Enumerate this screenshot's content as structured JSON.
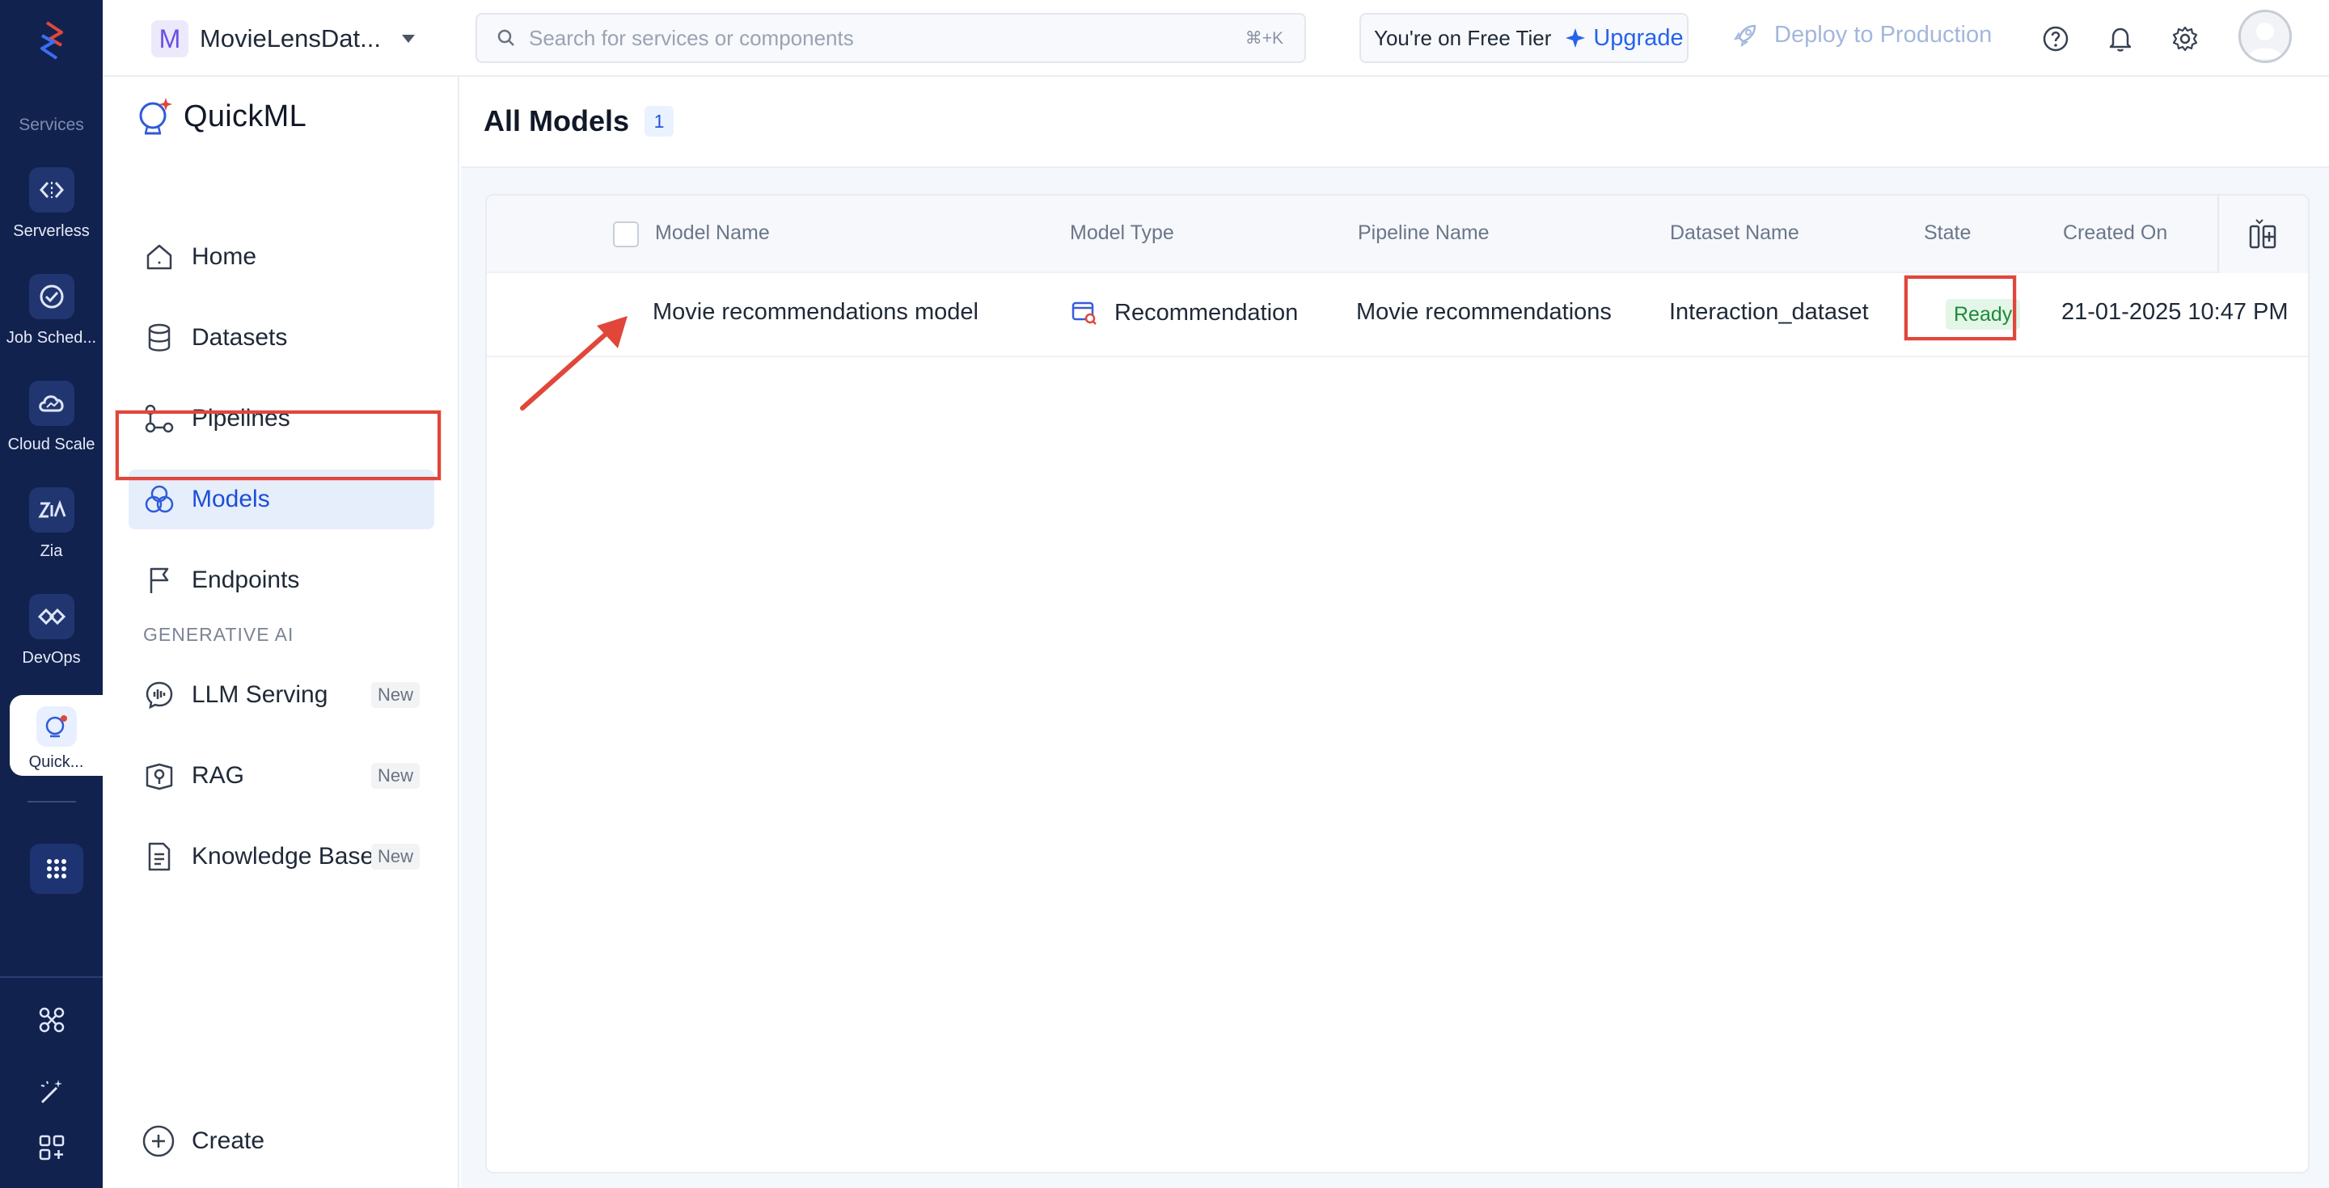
{
  "rail": {
    "section_label": "Services",
    "items": [
      {
        "label": "Serverless",
        "icon": "serverless-icon"
      },
      {
        "label": "Job Sched...",
        "icon": "job-scheduling-icon"
      },
      {
        "label": "Cloud Scale",
        "icon": "cloud-scale-icon"
      },
      {
        "label": "Zia",
        "icon": "zia-icon"
      },
      {
        "label": "DevOps",
        "icon": "devops-icon"
      },
      {
        "label": "Quick...",
        "icon": "quickml-icon",
        "active": true
      }
    ]
  },
  "topbar": {
    "project_initial": "M",
    "project_name": "MovieLensDat...",
    "search_placeholder": "Search for services or components",
    "search_shortcut": "⌘+K",
    "tier_text": "You're on Free Tier",
    "upgrade_label": "Upgrade",
    "deploy_label": "Deploy to Production"
  },
  "sidebar": {
    "brand": "QuickML",
    "items": [
      {
        "label": "Home"
      },
      {
        "label": "Datasets"
      },
      {
        "label": "Pipelines"
      },
      {
        "label": "Models",
        "active": true
      },
      {
        "label": "Endpoints"
      }
    ],
    "gen_ai_title": "GENERATIVE AI",
    "gen_ai_items": [
      {
        "label": "LLM Serving",
        "badge": "New"
      },
      {
        "label": "RAG",
        "badge": "New"
      },
      {
        "label": "Knowledge Base",
        "badge": "New"
      }
    ],
    "create_label": "Create"
  },
  "main": {
    "title": "All Models",
    "count": "1",
    "columns": [
      "Model Name",
      "Model Type",
      "Pipeline Name",
      "Dataset Name",
      "State",
      "Created On"
    ],
    "rows": [
      {
        "model_name": "Movie recommendations model",
        "model_type": "Recommendation",
        "pipeline_name": "Movie recommendations",
        "dataset_name": "Interaction_dataset",
        "state": "Ready",
        "created_on": "21-01-2025 10:47 PM"
      }
    ]
  },
  "colors": {
    "rail_bg": "#12224f",
    "accent": "#2563eb",
    "annotation": "#e0473a",
    "state_ready": "#1f8a3a"
  }
}
